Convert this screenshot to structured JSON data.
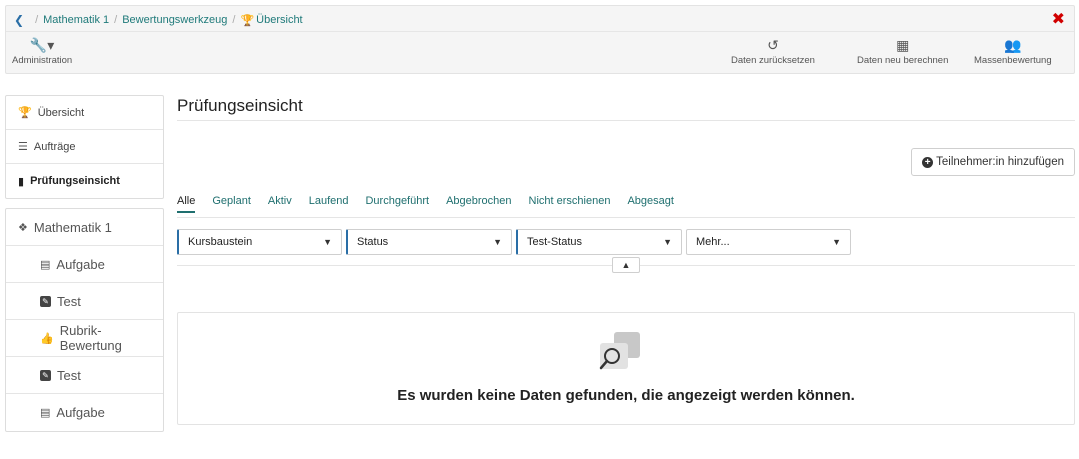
{
  "breadcrumb": {
    "back_icon": "chevron-left-icon",
    "items": [
      "Mathematik 1",
      "Bewertungswerkzeug",
      "Übersicht"
    ],
    "current_icon": "trophy-icon"
  },
  "close_icon": "close-icon",
  "toolbar": {
    "admin_label": "Administration",
    "reset_label": "Daten zurücksetzen",
    "recalc_label": "Daten neu berechnen",
    "mass_label": "Massenbewertung"
  },
  "sidebar_top": {
    "items": [
      "Übersicht",
      "Aufträge",
      "Prüfungseinsicht"
    ],
    "active": "Prüfungseinsicht"
  },
  "sidebar_course": {
    "items": [
      "Mathematik 1",
      "Aufgabe",
      "Test",
      "Rubrik-Bewertung",
      "Test",
      "Aufgabe"
    ]
  },
  "main": {
    "title": "Prüfungseinsicht",
    "add_button": "Teilnehmer:in hinzufügen",
    "tabs": [
      "Alle",
      "Geplant",
      "Aktiv",
      "Laufend",
      "Durchgeführt",
      "Abgebrochen",
      "Nicht erschienen",
      "Abgesagt"
    ],
    "active_tab": "Alle",
    "filters": [
      "Kursbaustein",
      "Status",
      "Test-Status",
      "Mehr..."
    ],
    "empty_message": "Es wurden keine Daten gefunden, die angezeigt werden können."
  },
  "colors": {
    "accent": "#1f6f6f",
    "link": "#2a6ea6",
    "close": "#d10000"
  }
}
